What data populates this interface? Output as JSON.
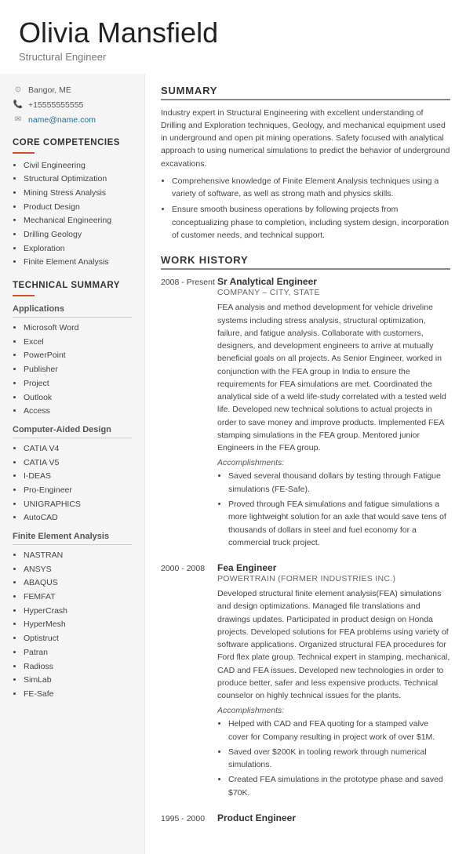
{
  "header": {
    "name": "Olivia Mansfield",
    "title": "Structural Engineer"
  },
  "contact": [
    {
      "icon": "📍",
      "text": "Bangor, ME",
      "type": "location"
    },
    {
      "icon": "📞",
      "text": "+15555555555",
      "type": "phone"
    },
    {
      "icon": "✉",
      "text": "name@name.com",
      "type": "email"
    }
  ],
  "core_competencies": {
    "title": "CORE COMPETENCIES",
    "items": [
      "Civil Engineering",
      "Structural Optimization",
      "Mining Stress Analysis",
      "Product Design",
      "Mechanical Engineering",
      "Drilling Geology",
      "Exploration",
      "Finite Element Analysis"
    ]
  },
  "technical_summary": {
    "title": "TECHNICAL SUMMARY",
    "subsections": [
      {
        "title": "Applications",
        "items": [
          "Microsoft Word",
          "Excel",
          "PowerPoint",
          "Publisher",
          "Project",
          "Outlook",
          "Access"
        ]
      },
      {
        "title": "Computer-Aided Design",
        "items": [
          "CATIA V4",
          "CATIA V5",
          "I-DEAS",
          "Pro-Engineer",
          "UNIGRAPHICS",
          "AutoCAD"
        ]
      },
      {
        "title": "Finite Element Analysis",
        "items": [
          "NASTRAN",
          "ANSYS",
          "ABAQUS",
          "FEMFAT",
          "HyperCrash",
          "HyperMesh",
          "Optistruct",
          "Patran",
          "Radioss",
          "SimLab",
          "FE-Safe"
        ]
      }
    ]
  },
  "summary": {
    "section_title": "SUMMARY",
    "paragraph": "Industry expert in Structural Engineering with excellent understanding of Drilling and Exploration techniques, Geology, and mechanical equipment used in underground and open pit mining operations. Safety focused with analytical approach to using numerical simulations to predict the behavior of underground excavations.",
    "bullets": [
      "Comprehensive knowledge of Finite Element Analysis techniques using a variety of software, as well as strong math and physics skills.",
      "Ensure smooth business operations by following projects from conceptualizing phase to completion, including system design, incorporation of customer needs, and technical support."
    ]
  },
  "work_history": {
    "section_title": "WORK HISTORY",
    "entries": [
      {
        "dates": "2008 - Present",
        "title": "Sr Analytical Engineer",
        "company": "COMPANY – CITY, STATE",
        "description": "FEA analysis and method development for vehicle driveline systems including stress analysis, structural optimization, failure, and fatigue analysis. Collaborate with customers, designers, and development engineers to arrive at mutually beneficial goals on all projects. As Senior Engineer, worked in conjunction with the FEA group in India to ensure the requirements for FEA simulations are met. Coordinated the analytical side of a weld life-study correlated with a tested weld life. Developed new technical solutions to actual projects in order to save money and improve products. Implemented FEA stamping simulations in the FEA group. Mentored junior Engineers in the FEA group.",
        "accomplishments_label": "Accomplishments:",
        "accomplishments": [
          "Saved several thousand dollars by testing through Fatigue simulations (FE-Safe).",
          "Proved through FEA simulations and fatigue simulations a more lightweight solution for an axle that would save tens of thousands of dollars in steel and fuel economy for a commercial truck project."
        ]
      },
      {
        "dates": "2000 - 2008",
        "title": "Fea Engineer",
        "company": "POWERTRAIN (FORMER INDUSTRIES INC.)",
        "description": "Developed structural finite element analysis(FEA) simulations and design optimizations. Managed file translations and drawings updates. Participated in product design on Honda projects. Developed solutions for FEA problems using variety of software applications. Organized structural FEA procedures for Ford flex plate group. Technical expert in stamping, mechanical, CAD and FEA issues. Developed new technologies in order to produce better, safer and less expensive products. Technical counselor on highly technical issues for the plants.",
        "accomplishments_label": "Accomplishments:",
        "accomplishments": [
          "Helped with CAD and FEA quoting for a stamped valve cover for Company resulting in project work of over $1M.",
          "Saved over $200K in tooling rework through numerical simulations.",
          "Created FEA simulations in the prototype phase and saved $70K."
        ]
      },
      {
        "dates": "1995 - 2000",
        "title": "Product Engineer",
        "company": "",
        "description": "",
        "accomplishments_label": "",
        "accomplishments": []
      }
    ]
  }
}
